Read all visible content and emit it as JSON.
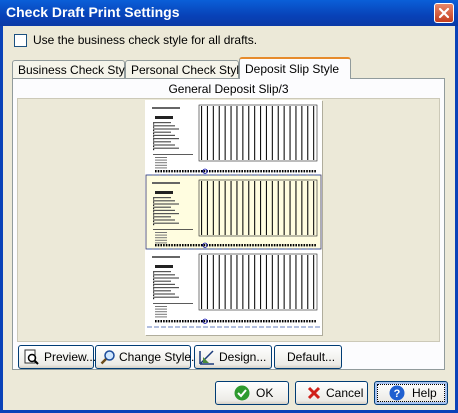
{
  "window": {
    "title": "Check Draft Print Settings",
    "close_icon": "close-icon"
  },
  "option": {
    "label": "Use the business check style for all drafts.",
    "checked": false
  },
  "tabs": [
    {
      "label": "Business Check Style",
      "active": false
    },
    {
      "label": "Personal Check Style",
      "active": false
    },
    {
      "label": "Deposit Slip Style",
      "active": true
    }
  ],
  "style_name": "General Deposit Slip/3",
  "buttons": {
    "preview": {
      "label": "Preview...",
      "icon": "preview-icon"
    },
    "change_style": {
      "label": "Change Style...",
      "icon": "magnifier-icon"
    },
    "design": {
      "label": "Design...",
      "icon": "design-icon"
    },
    "default": {
      "label": "Default..."
    },
    "ok": {
      "label": "OK",
      "icon": "checkmark-icon"
    },
    "cancel": {
      "label": "Cancel",
      "icon": "x-icon"
    },
    "help": {
      "label": "Help",
      "icon": "help-icon"
    }
  },
  "colors": {
    "titlebar": "#0842b8",
    "slip_highlight": "#fffde0",
    "accent_tab": "#e68b2c"
  }
}
